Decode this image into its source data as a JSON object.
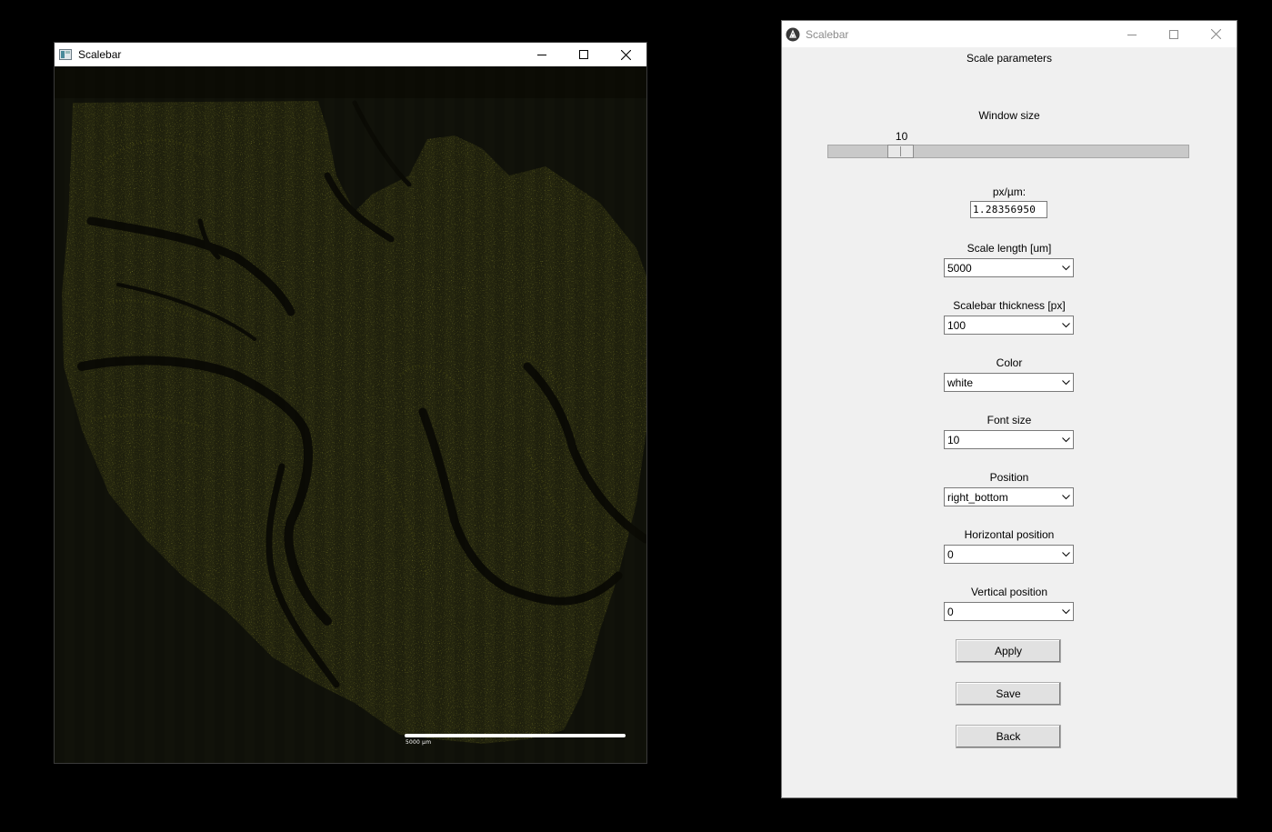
{
  "image_window": {
    "title": "Scalebar",
    "scalebar_label": "5000 µm"
  },
  "params_window": {
    "title": "Scalebar",
    "heading": "Scale parameters",
    "window_size": {
      "label": "Window size",
      "value": "10",
      "fraction": 0.18
    },
    "px_per_um": {
      "label": "px/µm:",
      "value": "1.28356950"
    },
    "scale_length": {
      "label": "Scale length [um]",
      "value": "5000"
    },
    "scalebar_thickness": {
      "label": "Scalebar thickness [px]",
      "value": "100"
    },
    "color": {
      "label": "Color",
      "value": "white"
    },
    "font_size": {
      "label": "Font size",
      "value": "10"
    },
    "position": {
      "label": "Position",
      "value": "right_bottom"
    },
    "horizontal_position": {
      "label": "Horizontal position",
      "value": "0"
    },
    "vertical_position": {
      "label": "Vertical position",
      "value": "0"
    },
    "buttons": {
      "apply": "Apply",
      "save": "Save",
      "back": "Back"
    }
  },
  "icons": {
    "minimize": "minimize-icon",
    "maximize": "maximize-icon",
    "close": "close-icon",
    "dropdown": "chevron-down-icon",
    "app": "app-icon"
  }
}
